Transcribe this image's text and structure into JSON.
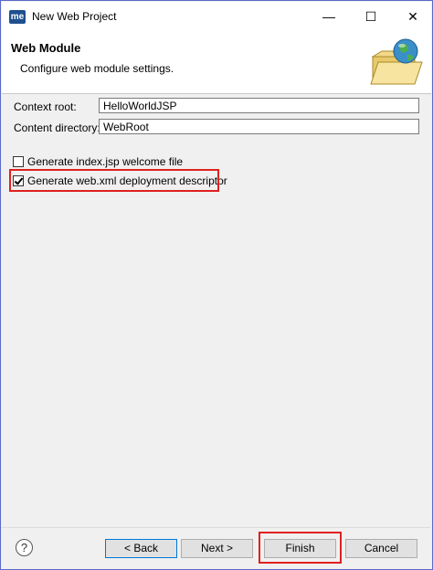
{
  "window": {
    "app_icon_text": "me",
    "title": "New Web Project",
    "minimize_glyph": "—",
    "maximize_glyph": "☐",
    "close_glyph": "✕"
  },
  "header": {
    "title": "Web Module",
    "description": "Configure web module settings.",
    "icon": "globe-folder-icon"
  },
  "form": {
    "context_root_label": "Context root:",
    "context_root_value": "HelloWorldJSP",
    "content_dir_label": "Content directory:",
    "content_dir_value": "WebRoot"
  },
  "options": [
    {
      "label": "Generate index.jsp welcome file",
      "checked": false
    },
    {
      "label": "Generate web.xml deployment descriptor",
      "checked": true
    }
  ],
  "footer": {
    "help_glyph": "?",
    "back_label": "< Back",
    "next_label": "Next >",
    "finish_label": "Finish",
    "cancel_label": "Cancel"
  },
  "colors": {
    "highlight": "#e02020",
    "focus_border": "#0078d7",
    "frame_border": "#5b68c8"
  }
}
